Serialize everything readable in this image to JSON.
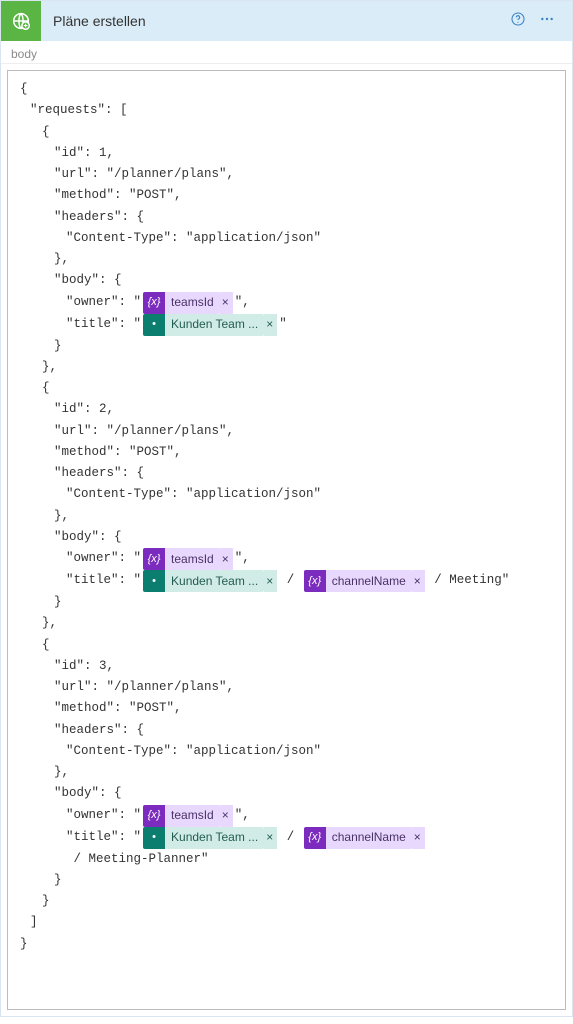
{
  "header": {
    "title": "Pläne erstellen"
  },
  "section": {
    "label": "body"
  },
  "json": {
    "open_brace": "{",
    "close_brace": "}",
    "requests_key": "\"requests\": [",
    "close_bracket": "]",
    "block_open": "{",
    "block_close": "}",
    "block_close_comma": "},",
    "id1": "\"id\": 1,",
    "id2": "\"id\": 2,",
    "id3": "\"id\": 3,",
    "url": "\"url\": \"/planner/plans\",",
    "method": "\"method\": \"POST\",",
    "headers_open": "\"headers\": {",
    "content_type": "\"Content-Type\": \"application/json\"",
    "body_open": "\"body\": {",
    "owner_prefix": "\"owner\": \"",
    "owner_suffix": "\",",
    "title_prefix": "\"title\": \"",
    "title_suffix_quote": "\"",
    "slash": " / ",
    "meeting_suffix": " / Meeting\"",
    "meeting_planner_suffix": " / Meeting-Planner\""
  },
  "tokens": {
    "teamsId": "teamsId",
    "channelName": "channelName",
    "kundenTeam": "Kunden Team ...",
    "fx": "{x}",
    "dyn_glyph": "•"
  }
}
